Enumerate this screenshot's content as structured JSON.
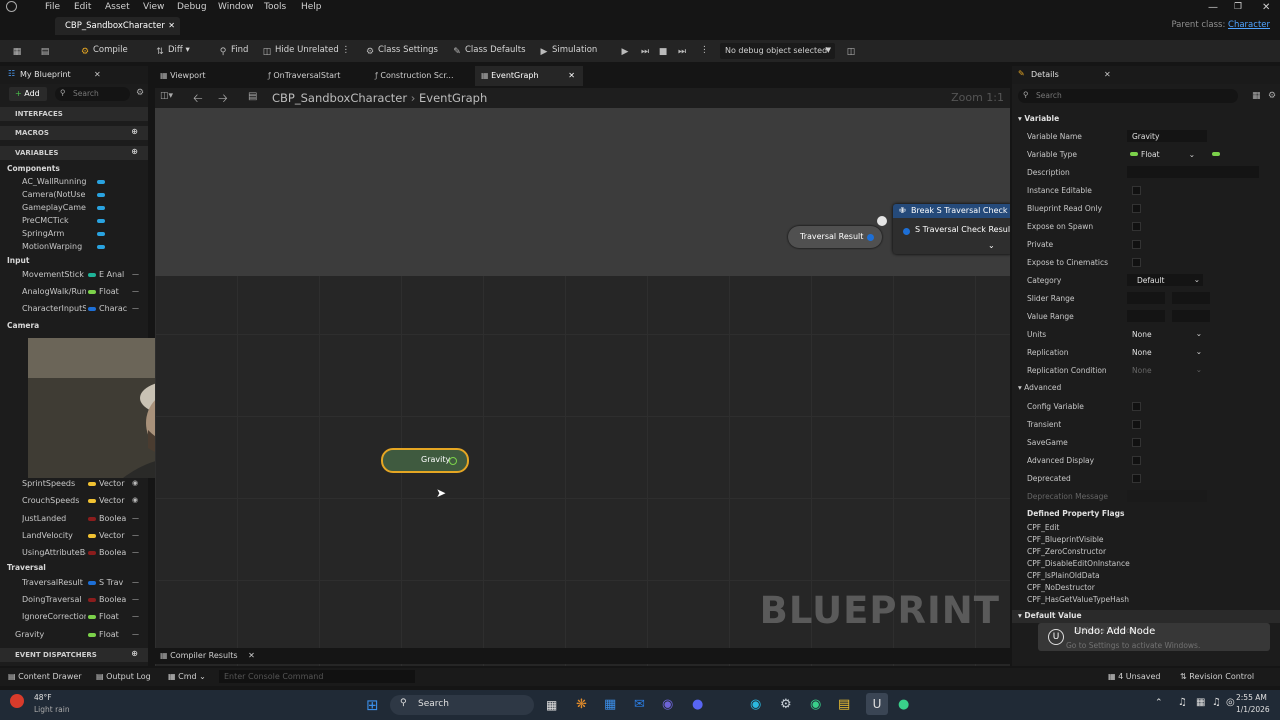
{
  "menu": [
    "File",
    "Edit",
    "Asset",
    "View",
    "Debug",
    "Window",
    "Tools",
    "Help"
  ],
  "doc_tab": "CBP_SandboxCharacter",
  "parent_class": {
    "label": "Parent class:",
    "value": "Character"
  },
  "toolbar": {
    "compile": "Compile",
    "diff": "Diff",
    "find": "Find",
    "hide_unrelated": "Hide Unrelated",
    "class_settings": "Class Settings",
    "class_defaults": "Class Defaults",
    "simulation": "Simulation",
    "debug_selector": "No debug object selected"
  },
  "my_blueprint": {
    "title": "My Blueprint",
    "add": "Add",
    "search_placeholder": "Search",
    "headers": {
      "interfaces": "INTERFACES",
      "macros": "MACROS",
      "variables": "VARIABLES",
      "event_dispatchers": "EVENT DISPATCHERS"
    },
    "categories": {
      "components": "Components",
      "input": "Input",
      "camera": "Camera",
      "traversal": "Traversal"
    },
    "components": [
      "AC_WallRunning",
      "Camera(NotUsed)",
      "GameplayCamera",
      "PreCMCTick",
      "SpringArm",
      "MotionWarping"
    ],
    "input": [
      {
        "name": "MovementStick",
        "type": "E Anal"
      },
      {
        "name": "AnalogWalk/Run",
        "type": "Float"
      },
      {
        "name": "CharacterInputState",
        "type": "Charac"
      }
    ],
    "mid_vars": [
      {
        "name": "SprintSpeeds",
        "type": "Vector"
      },
      {
        "name": "CrouchSpeeds",
        "type": "Vector"
      },
      {
        "name": "JustLanded",
        "type": "Boolea"
      },
      {
        "name": "LandVelocity",
        "type": "Vector"
      },
      {
        "name": "UsingAttributeBased",
        "type": "Boolea"
      }
    ],
    "traversal": [
      {
        "name": "TraversalResult",
        "type": "S Trav"
      },
      {
        "name": "DoingTraversal",
        "type": "Boolea"
      },
      {
        "name": "IgnoreCorrection",
        "type": "Float"
      },
      {
        "name": "Gravity",
        "type": "Float"
      }
    ]
  },
  "graph_tabs": [
    "Viewport",
    "OnTraversalStart",
    "Construction Scr...",
    "EventGraph"
  ],
  "breadcrumb": {
    "root": "CBP_SandboxCharacter",
    "leaf": "EventGraph"
  },
  "zoom": "Zoom 1:1",
  "nodes": {
    "traversal_result": "Traversal Result",
    "break_title": "Break S Traversal Check",
    "break_pin": "S Traversal Check Result",
    "gravity": "Gravity"
  },
  "watermark": "BLUEPRINT",
  "bottom_tab": "Compiler Results",
  "details": {
    "title": "Details",
    "search_placeholder": "Search",
    "sections": {
      "variable": "Variable",
      "advanced": "Advanced",
      "flags": "Defined Property Flags",
      "default_value": "Default Value"
    },
    "rows": {
      "variable_name": {
        "label": "Variable Name",
        "value": "Gravity"
      },
      "variable_type": {
        "label": "Variable Type",
        "value": "Float"
      },
      "description": "Description",
      "instance_editable": "Instance Editable",
      "read_only": "Blueprint Read Only",
      "expose_spawn": "Expose on Spawn",
      "private": "Private",
      "expose_cinematics": "Expose to Cinematics",
      "category": {
        "label": "Category",
        "value": "Default"
      },
      "slider_range": "Slider Range",
      "value_range": "Value Range",
      "units": {
        "label": "Units",
        "value": "None"
      },
      "replication": {
        "label": "Replication",
        "value": "None"
      },
      "replication_condition": {
        "label": "Replication Condition",
        "value": "None"
      },
      "config_variable": "Config Variable",
      "transient": "Transient",
      "savegame": "SaveGame",
      "advanced_display": "Advanced Display",
      "deprecated": "Deprecated",
      "deprecation_message": "Deprecation Message"
    },
    "flags": [
      "CPF_Edit",
      "CPF_BlueprintVisible",
      "CPF_ZeroConstructor",
      "CPF_DisableEditOnInstance",
      "CPF_IsPlainOldData",
      "CPF_NoDestructor",
      "CPF_HasGetValueTypeHash"
    ]
  },
  "toast": {
    "title": "Undo: Add Node",
    "activate_1": "Activate Windows",
    "activate_2": "Go to Settings to activate Windows."
  },
  "statusbar": {
    "content_drawer": "Content Drawer",
    "output_log": "Output Log",
    "cmd": "Cmd",
    "console_placeholder": "Enter Console Command",
    "unsaved": "4 Unsaved",
    "revision": "Revision Control"
  },
  "taskbar": {
    "temp": "48°F",
    "weather": "Light rain",
    "search": "Search",
    "time": "2:55 AM",
    "date": "1/1/2026"
  },
  "colors": {
    "float": "#7bd14a",
    "vector": "#f1c232",
    "bool": "#8b1d1d",
    "struct": "#1d6fd6",
    "object": "#29a3e0",
    "accent": "#e5a623"
  }
}
